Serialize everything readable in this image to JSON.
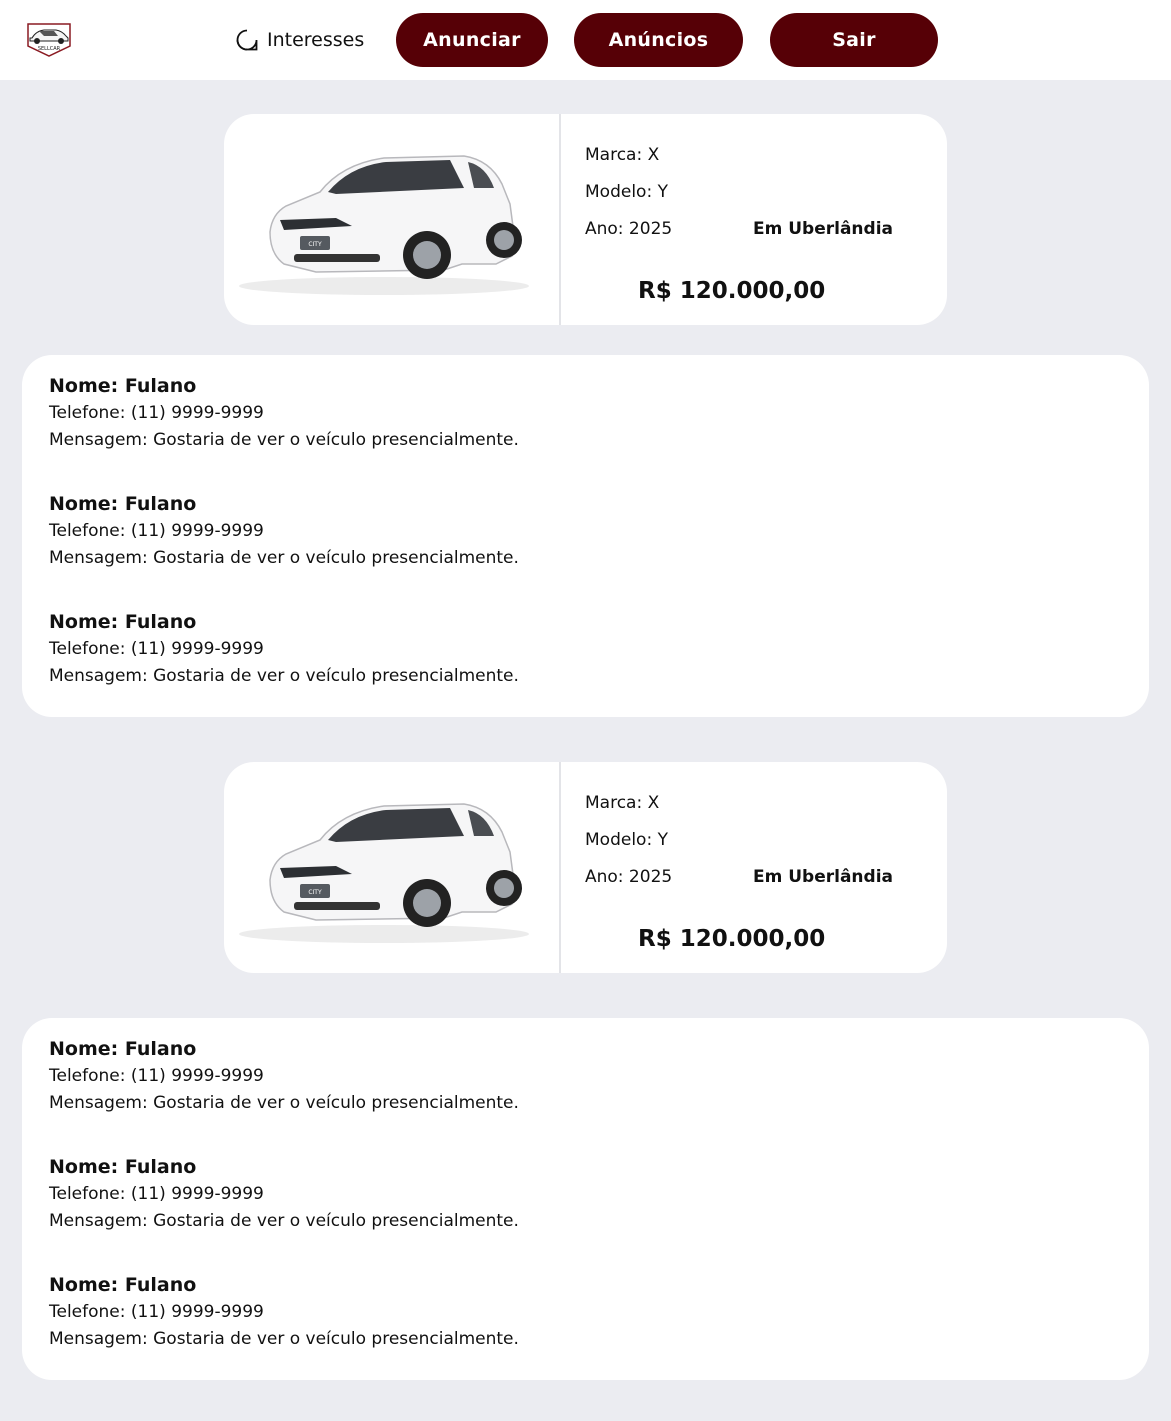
{
  "header": {
    "logo_text": "SELLCAR",
    "interesses_label": "Interesses",
    "anunciar_label": "Anunciar",
    "anuncios_label": "Anúncios",
    "sair_label": "Sair",
    "button_color": "#560006"
  },
  "listings": [
    {
      "marca": "Marca: X",
      "modelo": "Modelo: Y",
      "ano": "Ano: 2025",
      "cidade": "Em Uberlândia",
      "preco": "R$ 120.000,00",
      "car_badge": "CITY",
      "interests": [
        {
          "nome": "Nome: Fulano",
          "telefone": "Telefone: (11) 9999-9999",
          "mensagem": "Mensagem: Gostaria de ver o veículo presencialmente."
        },
        {
          "nome": "Nome: Fulano",
          "telefone": "Telefone: (11) 9999-9999",
          "mensagem": "Mensagem: Gostaria de ver o veículo presencialmente."
        },
        {
          "nome": "Nome: Fulano",
          "telefone": "Telefone: (11) 9999-9999",
          "mensagem": "Mensagem: Gostaria de ver o veículo presencialmente."
        }
      ]
    },
    {
      "marca": "Marca: X",
      "modelo": "Modelo: Y",
      "ano": "Ano: 2025",
      "cidade": "Em Uberlândia",
      "preco": "R$ 120.000,00",
      "car_badge": "CITY",
      "interests": [
        {
          "nome": "Nome: Fulano",
          "telefone": "Telefone: (11) 9999-9999",
          "mensagem": "Mensagem: Gostaria de ver o veículo presencialmente."
        },
        {
          "nome": "Nome: Fulano",
          "telefone": "Telefone: (11) 9999-9999",
          "mensagem": "Mensagem: Gostaria de ver o veículo presencialmente."
        },
        {
          "nome": "Nome: Fulano",
          "telefone": "Telefone: (11) 9999-9999",
          "mensagem": "Mensagem: Gostaria de ver o veículo presencialmente."
        }
      ]
    }
  ]
}
